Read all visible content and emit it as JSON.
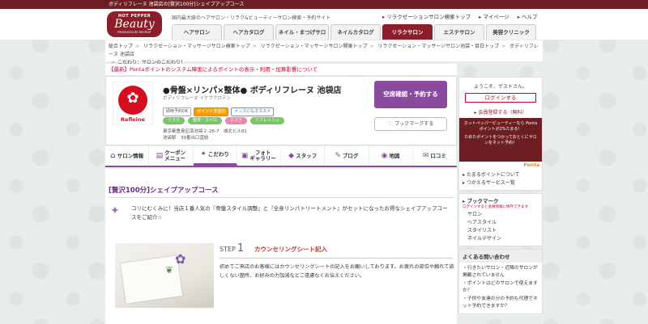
{
  "topbar": {
    "text": "ボディリフレーヌ 池袋店の[贅沢100分]シェイプアップコース"
  },
  "logo": {
    "top": "HOT PEPPER",
    "brand": "Beauty",
    "sub": "PRODUCED BY RECRUIT"
  },
  "header": {
    "tagline": "国内最大級のヘアサロン・リラク&ビューティーサロン検索・予約サイト"
  },
  "toplinks": [
    "リラクゼーションサロン検索トップ",
    "マイページ",
    "ヘルプ"
  ],
  "nav": [
    "ヘアサロン",
    "ヘアカタログ",
    "ネイル・まつげサロン",
    "ネイルカタログ",
    "リラクサロン",
    "エステサロン",
    "美容クリニック"
  ],
  "breadcrumb": [
    "総合トップ",
    "リラクゼーション・マッサージサロン検索トップ",
    "リラクゼーション・マッサージサロン関東トップ",
    "リラクゼーション・マッサージサロン池袋・目白トップ",
    "ボディリフレーヌ 池袋店"
  ],
  "breadcrumb_last": "こだわり：サロンのこだわり！",
  "notice": {
    "tag": "【最新】",
    "text": "Pontaポイントのシステム障害によるポイントの表示・利用・加算影響について"
  },
  "salon": {
    "logo_name": "Refleine",
    "name": "●骨盤×リンパ×整体● ボディリフレーヌ 池袋店",
    "kana": "ボディリフレーヌ イケブクロテン",
    "badges": [
      "即時予約OK",
      "ポイント加盟店",
      "メンズにもオススメ"
    ],
    "pills": [
      "リラク",
      "整体・カイロ",
      "エステ",
      "リフレッシュ"
    ],
    "address": "東京都豊島区南池袋２-26-7　城北ビル81",
    "station": "池袋駅　39番出口直結",
    "cta": "空席確認・予約する",
    "bookmark": "ブックマークする"
  },
  "tabs": [
    {
      "icon": "⌂",
      "label": "サロン情報"
    },
    {
      "icon": "▤",
      "label": "クーポン\nメニュー"
    },
    {
      "icon": "✦",
      "label": "こだわり"
    },
    {
      "icon": "▣",
      "label": "フォト\nギャラリー"
    },
    {
      "icon": "◆",
      "label": "スタッフ"
    },
    {
      "icon": "✎",
      "label": "ブログ"
    },
    {
      "icon": "◉",
      "label": "地図"
    },
    {
      "icon": "✉",
      "label": "口コミ"
    }
  ],
  "section": {
    "title": "[贅沢100分]シェイプアップコース",
    "intro": "コリにむくみに！当店１番人気の『骨盤スタイル調整』と『全身リンパトリートメント』がセットになったお得なシェイプアップコースをご紹介☆"
  },
  "step": {
    "label": "STEP",
    "num": "1",
    "title": "カウンセリングシート記入",
    "desc": "初めてご来店のお客様にはカウンセリングシートの記入をお願いしております。お疲れの部位や触れて欲しくない箇所、お好みの力加減などご遠慮なくお伝えください。"
  },
  "side": {
    "welcome": "ようこそ、ゲストさん。",
    "login": "ログインする",
    "register": "会員登録する（無料）",
    "ponta_text1": "ホットペッパービューティーなら Pontaポイントが2%たまる！",
    "ponta_text2": "ためたポイントをつかっておとくにサロンをネット予約！",
    "ponta_brand": "Ponta",
    "points_links": [
      "たまるポイントについて",
      "つかえるサービス一覧"
    ],
    "bookmark_title": "ブックマーク",
    "bookmark_note": "ログインすると会員情報に保存できます",
    "bookmark_items": [
      "サロン",
      "ヘアスタイル",
      "スタイリスト",
      "ネイルデザイン"
    ],
    "faq_title": "よくある問い合わせ",
    "faq": [
      "行きたいサロン・近隣のサロンが掲載されていません",
      "ポイントはどのサロンで使えますか？",
      "子供や友達の分の予約も代理でネット予約できますか？"
    ]
  }
}
